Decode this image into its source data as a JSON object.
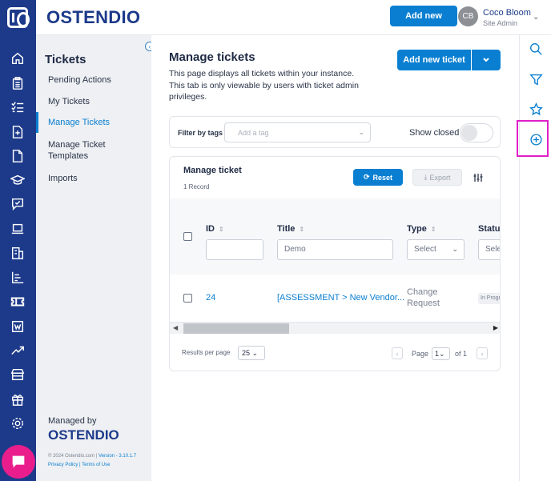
{
  "app": {
    "brand": "OSTENDIO",
    "add_new_label": "Add new",
    "user": {
      "initials": "CB",
      "name": "Coco Bloom",
      "role": "Site Admin"
    }
  },
  "rail_icons": [
    "logo-icon",
    "home-icon",
    "clipboard-icon",
    "checklist-icon",
    "add-document-icon",
    "document-icon",
    "graduation-cap-icon",
    "chat-box-icon",
    "laptop-icon",
    "building-icon",
    "bar-chart-icon",
    "ticket-icon",
    "word-icon",
    "trending-up-icon",
    "store-icon",
    "gift-icon",
    "settings-icon",
    "chat-bubble-icon"
  ],
  "subnav": {
    "title": "Tickets",
    "items": [
      {
        "label": "Pending Actions"
      },
      {
        "label": "My Tickets"
      },
      {
        "label": "Manage Tickets"
      },
      {
        "label": "Manage Ticket Templates"
      },
      {
        "label": "Imports"
      }
    ],
    "managed_by": "Managed by",
    "managed_logo": "OSTENDIO",
    "footer_copyright": "© 2024 Ostendio.com | ",
    "footer_version": "Version - 3.10.1.7",
    "footer_links": "Privacy Policy | Terms of Use"
  },
  "page": {
    "title": "Manage tickets",
    "description": "This page displays all tickets within your instance. This tab is only viewable by users with ticket admin privileges.",
    "add_ticket_label": "Add new ticket"
  },
  "filter": {
    "label": "Filter by tags",
    "tag_placeholder": "Add a tag",
    "show_closed_label": "Show closed",
    "show_closed_on": false
  },
  "table": {
    "title": "Manage ticket",
    "record_count": "1 Record",
    "reset_label": "Reset",
    "export_label": "Export",
    "columns": [
      "ID",
      "Title",
      "Type",
      "Status"
    ],
    "filters": {
      "id": "",
      "title": "Demo",
      "type": "Select",
      "status": "Select"
    },
    "rows": [
      {
        "id": "24",
        "title": "[ASSESSMENT > New Vendor...",
        "type": "Change Request",
        "status": "In Progress"
      }
    ]
  },
  "pagination": {
    "results_per_page_label": "Results per page",
    "results_per_page": "25",
    "page_label": "Page",
    "page": "1",
    "of_label": "of 1"
  },
  "right_rail_icons": [
    "search-icon",
    "filter-icon",
    "star-icon",
    "add-circle-icon"
  ],
  "colors": {
    "rail": "#1d3a8a",
    "accent": "#0a7fd1",
    "highlight": "#e020c8",
    "chat": "#e91e8c"
  }
}
